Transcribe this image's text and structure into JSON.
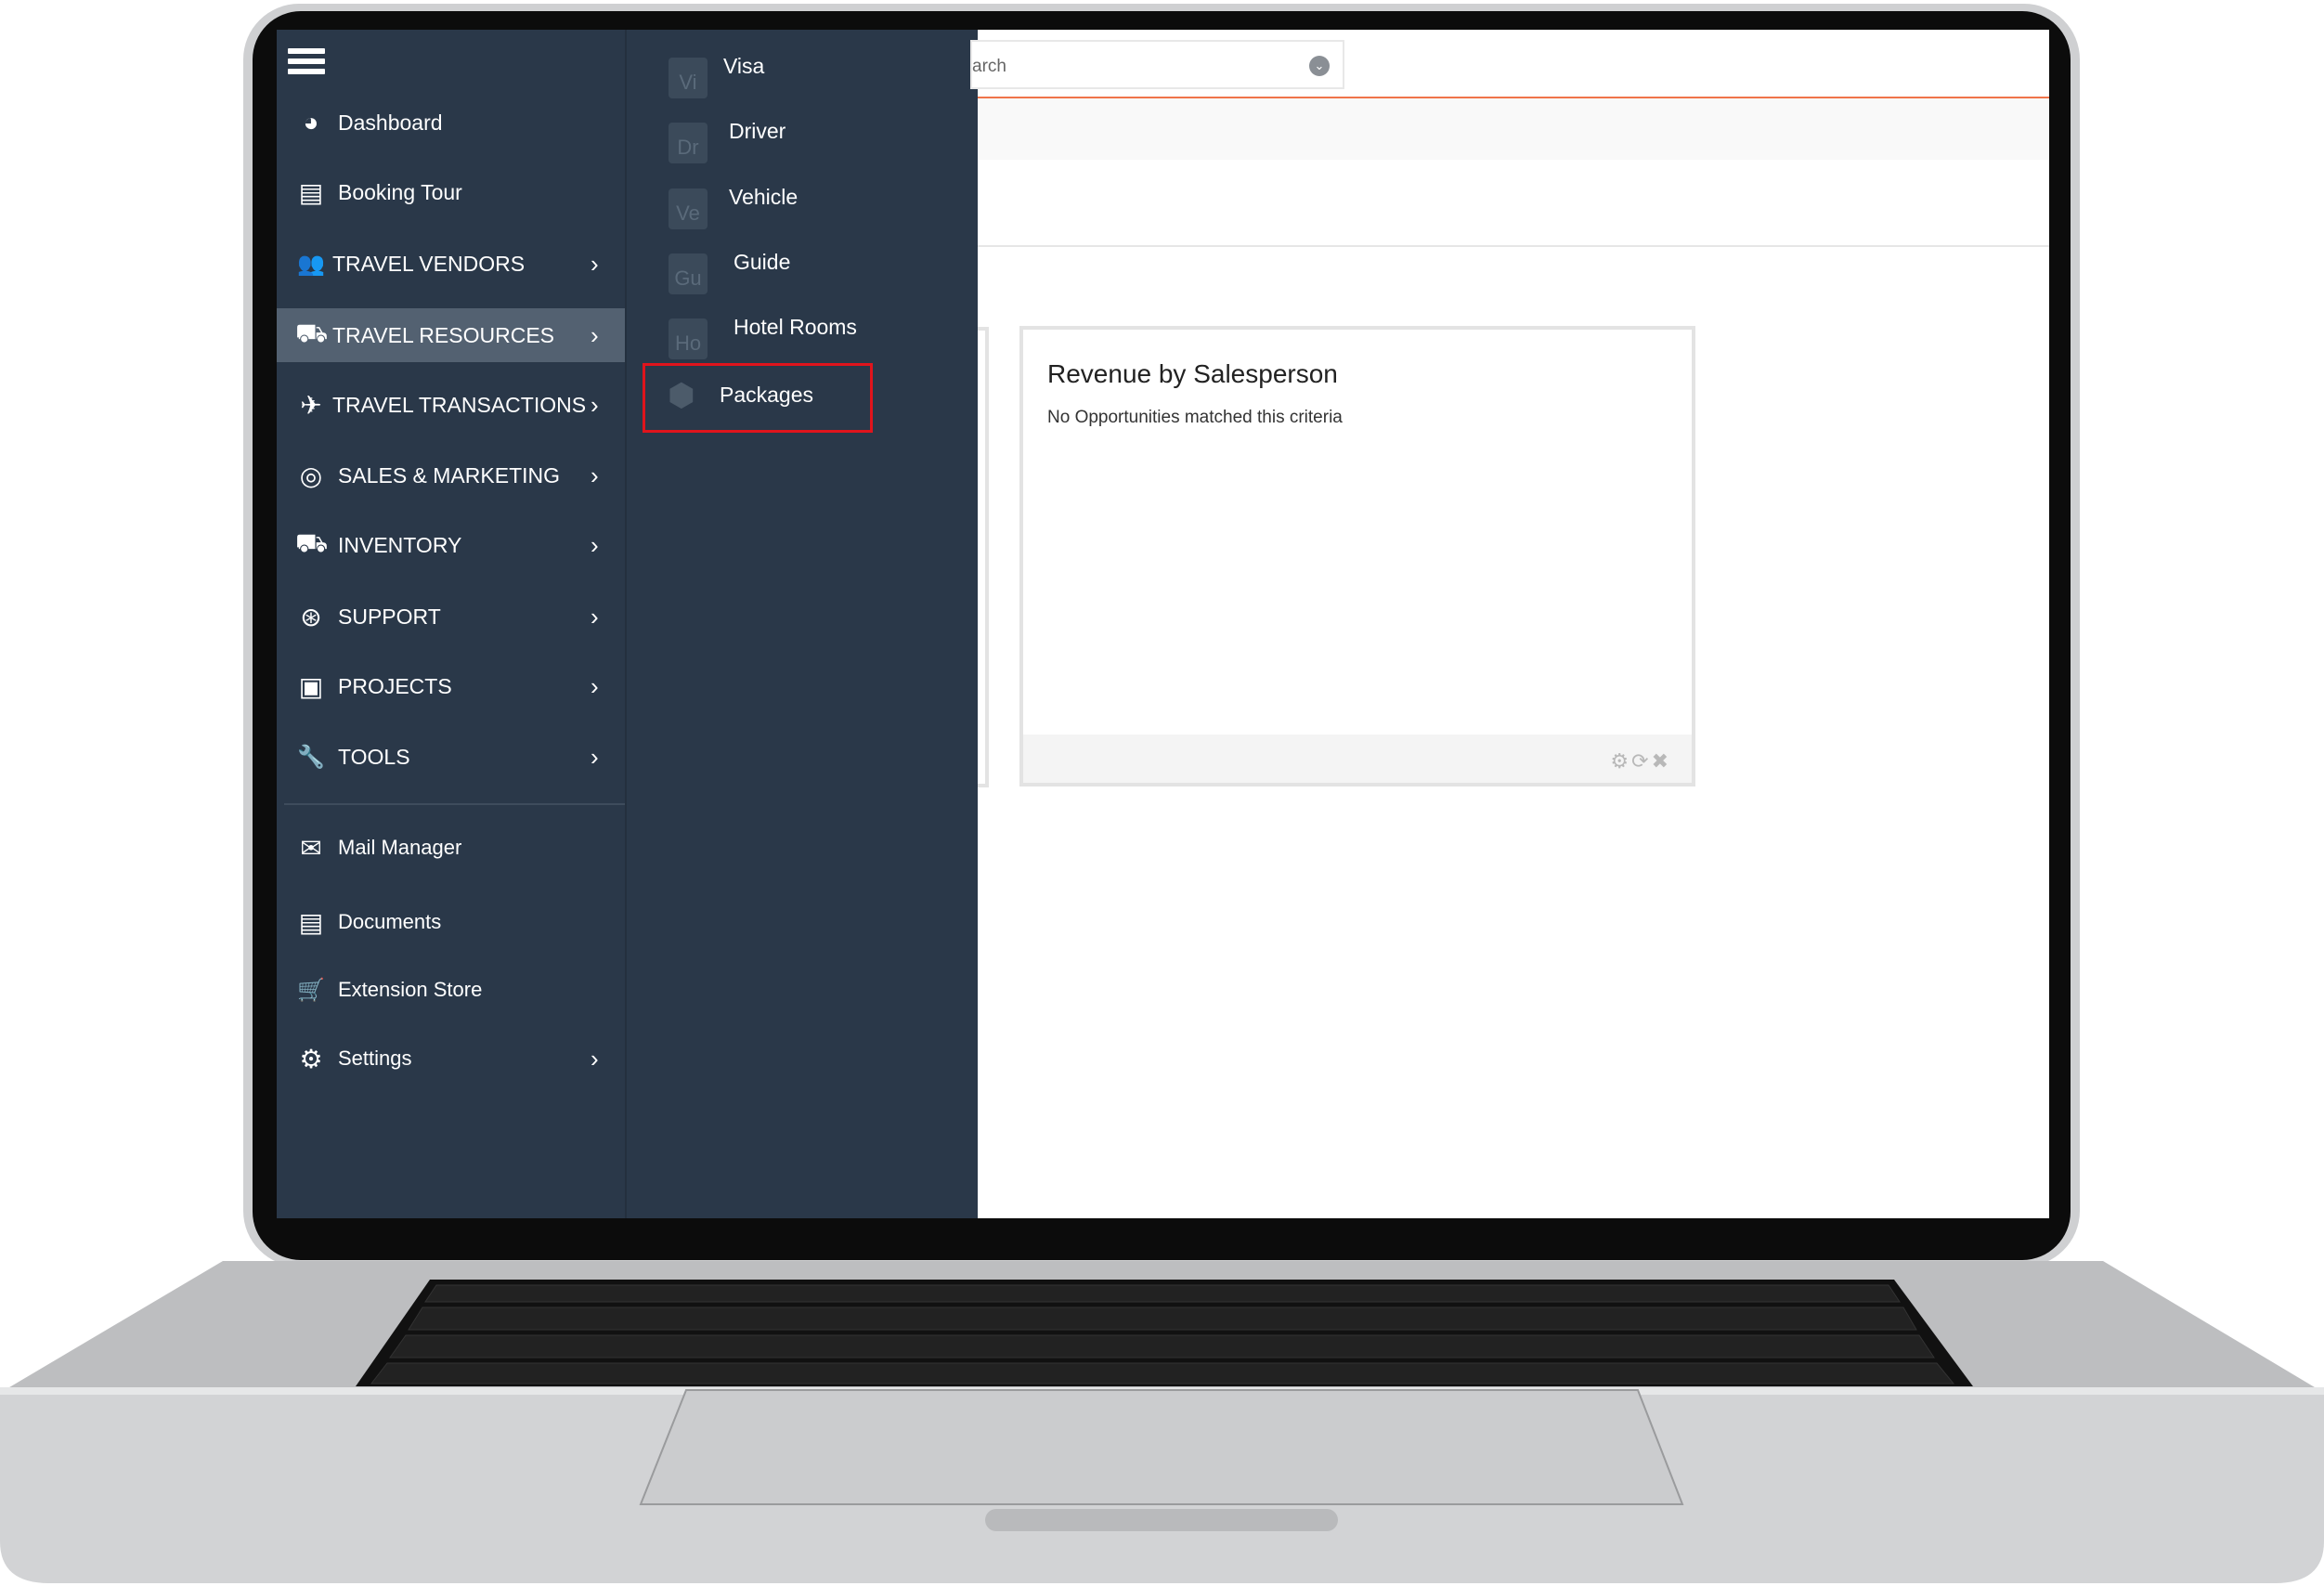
{
  "sidebar": {
    "items": [
      {
        "label": "Dashboard",
        "icon": "dashboard-icon",
        "glyph": "◕"
      },
      {
        "label": "Booking Tour",
        "icon": "book-icon",
        "glyph": "▤"
      },
      {
        "label": "TRAVEL VENDORS",
        "icon": "users-icon",
        "glyph": "👥",
        "chevron": "›"
      },
      {
        "label": "TRAVEL RESOURCES",
        "icon": "cart-icon",
        "glyph": "⛟",
        "chevron": "›",
        "active": true
      },
      {
        "label": "TRAVEL TRANSACTIONS",
        "icon": "plane-icon",
        "glyph": "✈",
        "chevron": "›"
      },
      {
        "label": "SALES & MARKETING",
        "icon": "target-icon",
        "glyph": "◎",
        "chevron": "›"
      },
      {
        "label": "INVENTORY",
        "icon": "inventory-icon",
        "glyph": "⛟",
        "chevron": "›"
      },
      {
        "label": "SUPPORT",
        "icon": "lifebuoy-icon",
        "glyph": "⊛",
        "chevron": "›"
      },
      {
        "label": "PROJECTS",
        "icon": "briefcase-icon",
        "glyph": "▣",
        "chevron": "›"
      },
      {
        "label": "TOOLS",
        "icon": "wrench-icon",
        "glyph": "🔧",
        "chevron": "›"
      },
      {
        "label": "Mail Manager",
        "icon": "mail-icon",
        "glyph": "✉"
      },
      {
        "label": "Documents",
        "icon": "document-icon",
        "glyph": "▤"
      },
      {
        "label": "Extension Store",
        "icon": "cart-icon",
        "glyph": "🛒"
      },
      {
        "label": "Settings",
        "icon": "gear-icon",
        "glyph": "⚙",
        "chevron": "›"
      }
    ]
  },
  "submenu": {
    "items": [
      {
        "badge": "Vi",
        "label": "Visa"
      },
      {
        "badge": "Dr",
        "label": "Driver"
      },
      {
        "badge": "Ve",
        "label": "Vehicle"
      },
      {
        "badge": "Gu",
        "label": "Guide"
      },
      {
        "badge": "Ho",
        "label": "Hotel Rooms"
      },
      {
        "badge": "",
        "label": "Packages",
        "icon": "box-icon",
        "highlighted": true
      }
    ]
  },
  "search": {
    "visible_text": "arch"
  },
  "widget": {
    "title": "Revenue by Salesperson",
    "message": "No Opportunities matched this criteria",
    "tools": [
      "gear-icon",
      "refresh-icon",
      "close-icon"
    ]
  },
  "colors": {
    "sidebar": "#2a3849",
    "active": "#536171",
    "accent": "#f0744a",
    "highlight_box": "#e0141c"
  }
}
